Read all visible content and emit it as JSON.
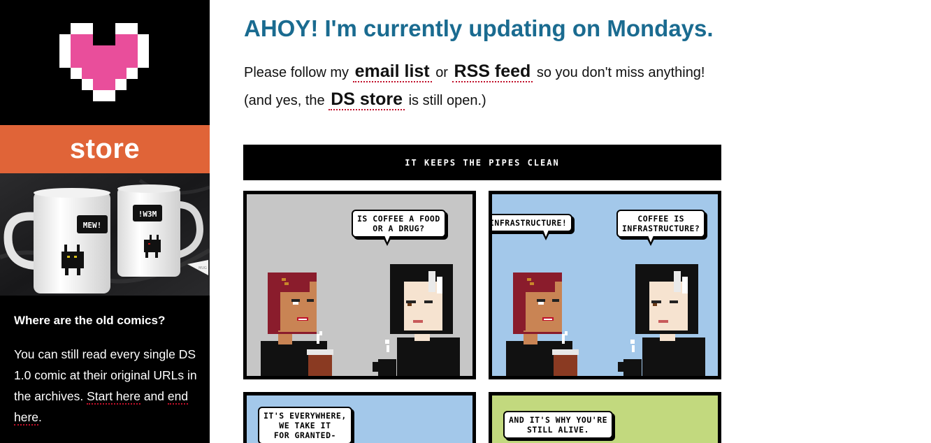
{
  "sidebar": {
    "store_label": "store",
    "logo_icon": "pixel-heart-icon",
    "colors": {
      "heart": "#e94e9b",
      "banner": "#e06438"
    },
    "old_comics_title": "Where are the old comics?",
    "old_comics_text_1": "You can still read every single DS 1.0 comic at their original URLs in the archives.",
    "start_link": "Start here",
    "and_text": "and",
    "end_link": "end here",
    "period": ".",
    "mug_text_front": "MEW!",
    "mug_text_back": "!W3M",
    "mug_tag": "MUG"
  },
  "main": {
    "headline": "AHOY! I'm currently updating on Mondays.",
    "intro_1": "Please follow my",
    "email_link": "email list",
    "or_text": "or",
    "rss_link": "RSS feed",
    "intro_2": "so you don't miss anything! (and yes, the",
    "store_link": "DS store",
    "intro_3": "is still open.)",
    "headline_color": "#1a6b90"
  },
  "comic": {
    "title": "IT KEEPS THE PIPES CLEAN",
    "panels": [
      {
        "bg": "#c6c6c6",
        "bubbles": [
          "IS COFFEE A FOOD\nOR A DRUG?"
        ]
      },
      {
        "bg": "#a3c8ea",
        "bubbles": [
          "INFRASTRUCTURE!",
          "COFFEE IS\nINFRASTRUCTURE?"
        ]
      },
      {
        "bg": "#a3c8ea",
        "bubbles": [
          "IT'S EVERYWHERE,\nWE TAKE IT\nFOR GRANTED-"
        ]
      },
      {
        "bg": "#c2d97e",
        "bubbles": [
          "AND IT'S WHY YOU'RE\nSTILL ALIVE."
        ]
      }
    ]
  }
}
